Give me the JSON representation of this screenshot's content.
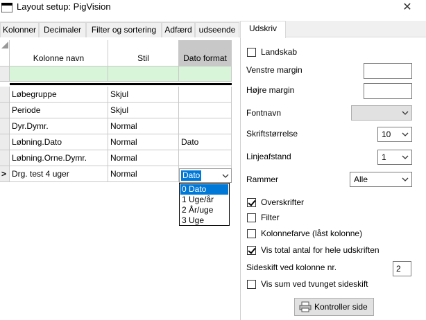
{
  "window": {
    "title": "Layout setup: PigVision",
    "close_glyph": "✕"
  },
  "tabs": [
    {
      "label": "Kolonner"
    },
    {
      "label": "Decimaler"
    },
    {
      "label": "Filter og sortering"
    },
    {
      "label": "Adfærd"
    },
    {
      "label": "udseende"
    },
    {
      "label": "Udskriv"
    }
  ],
  "grid": {
    "headers": {
      "name": "Kolonne navn",
      "style": "Stil",
      "date_format": "Dato format"
    },
    "rows": [
      {
        "name": "Løbegruppe",
        "style": "Skjul",
        "date_format": ""
      },
      {
        "name": "Periode",
        "style": "Skjul",
        "date_format": ""
      },
      {
        "name": "Dyr.Dymr.",
        "style": "Normal",
        "date_format": ""
      },
      {
        "name": "Løbning.Dato",
        "style": "Normal",
        "date_format": "Dato"
      },
      {
        "name": "Løbning.Orne.Dymr.",
        "style": "Normal",
        "date_format": ""
      },
      {
        "name": "Drg. test 4 uger",
        "style": "Normal",
        "date_format": "Dato"
      }
    ],
    "current_row_marker": ">",
    "date_format_dropdown": {
      "value": "Dato",
      "options": [
        "0 Dato",
        "1 Uge/år",
        "2 År/uge",
        "3 Uge"
      ]
    }
  },
  "print": {
    "landscape": {
      "label": "Landskab",
      "checked": false
    },
    "left_margin": {
      "label": "Venstre margin",
      "value": ""
    },
    "right_margin": {
      "label": "Højre margin",
      "value": ""
    },
    "font_name": {
      "label": "Fontnavn",
      "value": ""
    },
    "font_size": {
      "label": "Skriftstørrelse",
      "value": "10"
    },
    "line_spacing": {
      "label": "Linjeafstand",
      "value": "1"
    },
    "borders": {
      "label": "Rammer",
      "value": "Alle"
    },
    "headings": {
      "label": "Overskrifter",
      "checked": true
    },
    "filter": {
      "label": "Filter",
      "checked": false
    },
    "column_color": {
      "label": "Kolonnefarve (låst kolonne)",
      "checked": false
    },
    "show_total": {
      "label": "Vis total antal for hele udskriften",
      "checked": true
    },
    "page_break_column": {
      "label": "Sideskift ved kolonne nr.",
      "value": "2"
    },
    "sum_on_break": {
      "label": "Vis sum ved tvunget sideskift",
      "checked": false
    },
    "check_page_button": {
      "label": "Kontroller side"
    }
  },
  "colors": {
    "selection": "#0078d7",
    "green_row": "#d9f5d9",
    "selected_header": "#c8c8c8"
  }
}
